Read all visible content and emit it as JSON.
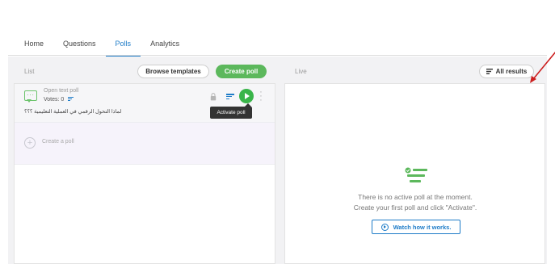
{
  "nav": {
    "tabs": [
      {
        "label": "Home",
        "active": false
      },
      {
        "label": "Questions",
        "active": false
      },
      {
        "label": "Polls",
        "active": true
      },
      {
        "label": "Analytics",
        "active": false
      }
    ]
  },
  "toolbar": {
    "list_label": "List",
    "browse_label": "Browse templates",
    "create_label": "Create poll",
    "live_label": "Live",
    "results_label": "All results"
  },
  "poll": {
    "type_label": "Open text poll",
    "votes_label": "Votes: 0",
    "question": "لماذا التحول الرقمي في العملية التعليمية ؟؟؟",
    "tooltip": "Activate poll"
  },
  "create_poll_row": {
    "label": "Create a poll"
  },
  "live_panel": {
    "empty_line1": "There is no active poll at the moment.",
    "empty_line2": "Create your first poll and click \"Activate\".",
    "watch_label": "Watch how it works."
  },
  "colors": {
    "accent_blue": "#1e7cc8",
    "accent_green": "#5cb85c",
    "annotation_red": "#cc1f1f"
  },
  "icons": {
    "poll_type": "speech-bubble-icon",
    "lock": "lock-icon",
    "results": "results-bars-icon",
    "activate": "play-icon",
    "more": "more-vertical-icon",
    "add": "plus-circle-icon",
    "empty_state": "poll-bars-check-icon",
    "watch": "play-circle-icon"
  }
}
